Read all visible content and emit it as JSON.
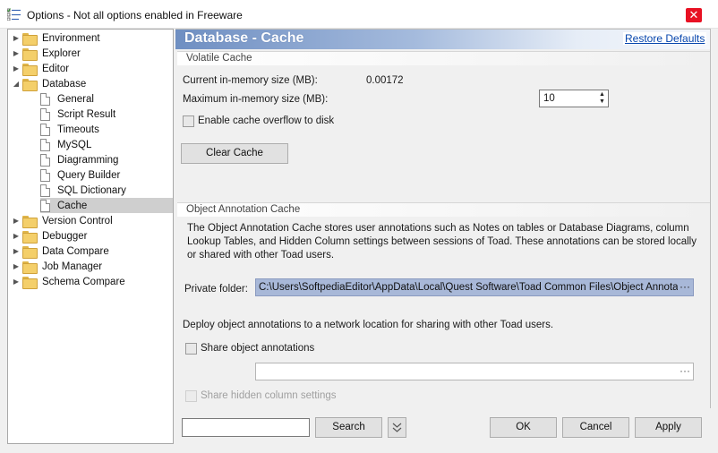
{
  "window": {
    "title": "Options - Not all options enabled in Freeware",
    "close_glyph": "✕"
  },
  "tree": {
    "items": [
      {
        "label": "Environment",
        "type": "folder",
        "expander": "▶"
      },
      {
        "label": "Explorer",
        "type": "folder",
        "expander": "▶"
      },
      {
        "label": "Editor",
        "type": "folder",
        "expander": "▶"
      },
      {
        "label": "Database",
        "type": "folder",
        "expander": "◢"
      },
      {
        "label": "General",
        "type": "page"
      },
      {
        "label": "Script Result",
        "type": "page"
      },
      {
        "label": "Timeouts",
        "type": "page"
      },
      {
        "label": "MySQL",
        "type": "page"
      },
      {
        "label": "Diagramming",
        "type": "page"
      },
      {
        "label": "Query Builder",
        "type": "page"
      },
      {
        "label": "SQL Dictionary",
        "type": "page"
      },
      {
        "label": "Cache",
        "type": "page",
        "selected": true
      },
      {
        "label": "Version Control",
        "type": "folder",
        "expander": "▶"
      },
      {
        "label": "Debugger",
        "type": "folder",
        "expander": "▶"
      },
      {
        "label": "Data Compare",
        "type": "folder",
        "expander": "▶"
      },
      {
        "label": "Job Manager",
        "type": "folder",
        "expander": "▶"
      },
      {
        "label": "Schema Compare",
        "type": "folder",
        "expander": "▶"
      }
    ]
  },
  "page": {
    "title": "Database - Cache",
    "restore_defaults": "Restore Defaults"
  },
  "volatile": {
    "header": "Volatile Cache",
    "current_label": "Current in-memory size (MB):",
    "current_value": "0.00172",
    "max_label": "Maximum in-memory size (MB):",
    "max_value": "10",
    "overflow_label": "Enable cache overflow to disk",
    "overflow_checked": false,
    "clear_button": "Clear Cache",
    "spin_up": "▲",
    "spin_down": "▼"
  },
  "annotation": {
    "header": "Object Annotation Cache",
    "description": "The Object Annotation Cache stores user annotations such as Notes on tables or Database Diagrams, column Lookup Tables, and Hidden Column settings between sessions of Toad. These annotations can be stored locally or shared with other Toad users.",
    "private_folder_label": "Private folder:",
    "private_folder_value": "C:\\Users\\SoftpediaEditor\\AppData\\Local\\Quest Software\\Toad Common Files\\Object Annotation Cache",
    "browse_glyph": "···",
    "deploy_text": "Deploy object annotations to a network location for sharing with other Toad users.",
    "share_label": "Share object annotations",
    "share_checked": false,
    "hidden_settings_label": "Share hidden column settings"
  },
  "footer": {
    "search_value": "",
    "search_button": "Search",
    "ok": "OK",
    "cancel": "Cancel",
    "apply": "Apply"
  },
  "colors": {
    "banner_start": "#6f8fc2",
    "selection": "#cfcfcf",
    "folder_field": "#a8b8d8",
    "close": "#e81123"
  }
}
